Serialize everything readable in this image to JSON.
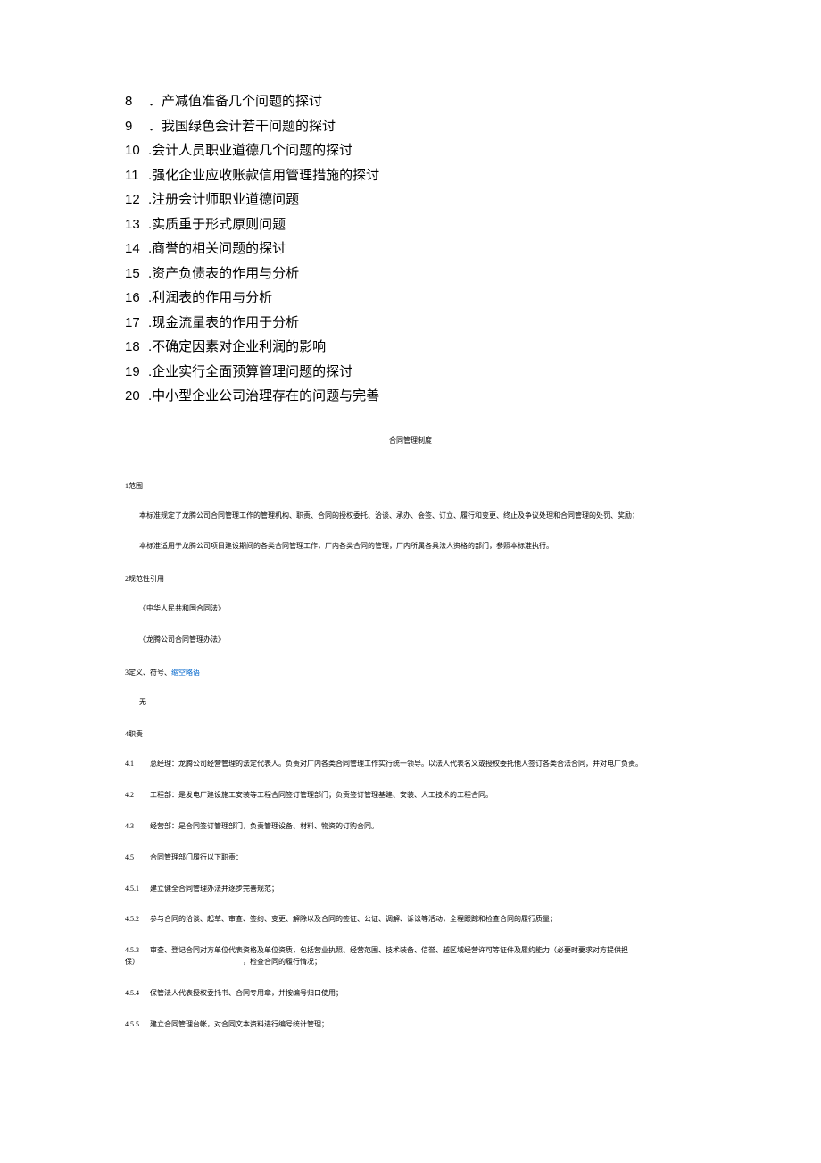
{
  "topics": [
    {
      "num": "8",
      "text": "．产减值准备几个问题的探讨"
    },
    {
      "num": "9",
      "text": "．我国绿色会计若干问题的探讨"
    },
    {
      "num": "10",
      "text": " .会计人员职业道德几个问题的探讨"
    },
    {
      "num": "11",
      "text": " .强化企业应收账款信用管理措施的探讨"
    },
    {
      "num": "12",
      "text": " .注册会计师职业道德问题"
    },
    {
      "num": "13",
      "text": " .实质重于形式原则问题"
    },
    {
      "num": "14",
      "text": " .商誉的相关问题的探讨"
    },
    {
      "num": "15",
      "text": " .资产负债表的作用与分析"
    },
    {
      "num": "16",
      "text": " .利润表的作用与分析"
    },
    {
      "num": "17",
      "text": " .现金流量表的作用于分析"
    },
    {
      "num": "18",
      "text": " .不确定因素对企业利润的影响"
    },
    {
      "num": "19",
      "text": " .企业实行全面预算管理问题的探讨"
    },
    {
      "num": "20",
      "text": " .中小型企业公司治理存在的问题与完善"
    }
  ],
  "doc_title": "合同管理制度",
  "s1": {
    "heading": "1范围",
    "p1": "本标准规定了龙腾公司合同管理工作的管理机构、职责、合同的授权委托、洽谈、承办、会签、订立、履行和变更、终止及争议处理和合同管理的处罚、奖励；",
    "p2": "本标准适用于龙腾公司项目建设期间的各类合同管理工作，厂内各类合同的管理，厂内所属各具法人资格的部门，参照本标准执行。"
  },
  "s2": {
    "heading": "2规范性引用",
    "p1": "《中华人民共和国合同法》",
    "p2": "《龙腾公司合同管理办法》"
  },
  "s3": {
    "heading_prefix": "3定义、符号、",
    "heading_link": "缩空略语",
    "p1": "无"
  },
  "s4": {
    "heading": "4职责",
    "i41": {
      "num": "4.1",
      "text": "总经理：龙腾公司经营管理的法定代表人。负责对厂内各类合同管理工作实行统一领导。以法人代表名义或授权委托他人签订各类合法合同，并对电厂负责。"
    },
    "i42": {
      "num": "4.2",
      "text": "工程部：是发电厂建设施工安装等工程合同签订管理部门；负责签订管理基建、安装、人工技术的工程合同。"
    },
    "i43": {
      "num": "4.3",
      "text": "经营部：是合同签订管理部门，负责管理设备、材料、物资的订购合同。"
    },
    "i45": {
      "num": "4.5",
      "text": "合同管理部门履行以下职责："
    },
    "i451": {
      "num": "4.5.1",
      "text": "建立健全合同管理办法并逐步完善规范；"
    },
    "i452": {
      "num": "4.5.2",
      "text": "参与合同的洽谈、起草、审查、签约、变更、解除以及合同的签证、公证、调解、诉讼等活动，全程跟踪和检查合同的履行质量；"
    },
    "i453": {
      "num": "4.5.3",
      "text": "审查、登记合同对方单位代表资格及单位资质，包括营业执照、经营范围、技术装备、信誉、越区域经营许可等证件及履约能力（必要时要求对方提供担保）",
      "trailing": "，检查合同的履行情况；"
    },
    "i454": {
      "num": "4.5.4",
      "text": "保管法人代表授权委托书、合同专用章，并按编号归口使用；"
    },
    "i455": {
      "num": "4.5.5",
      "text": "建立合同管理台帐，对合同文本资料进行编号统计管理；"
    }
  }
}
